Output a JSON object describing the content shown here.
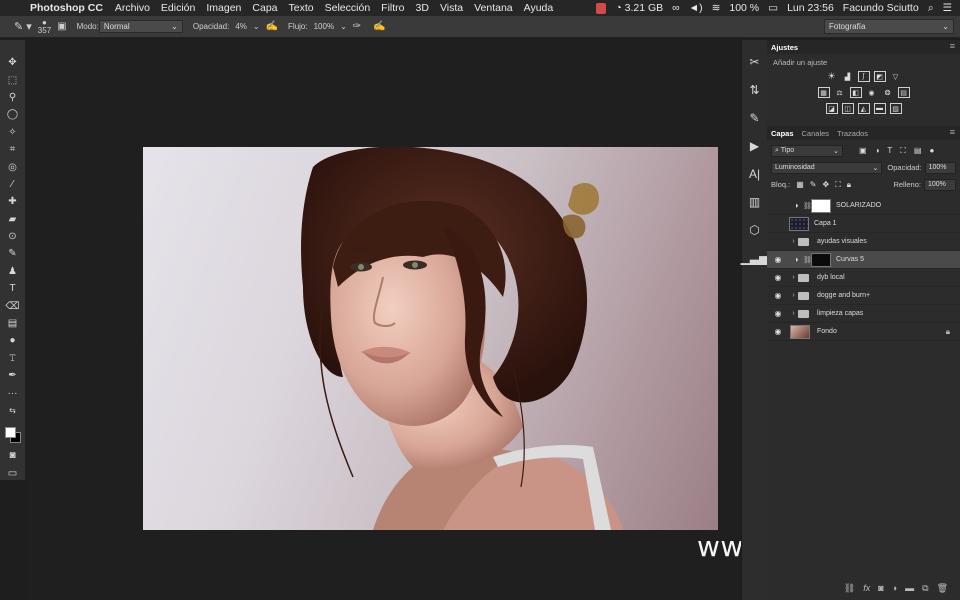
{
  "menubar": {
    "app_name": "Photoshop CC",
    "items": [
      "Archivo",
      "Edición",
      "Imagen",
      "Capa",
      "Texto",
      "Selección",
      "Filtro",
      "3D",
      "Vista",
      "Ventana",
      "Ayuda"
    ],
    "memory": "3.21 GB",
    "battery": "100 %",
    "clock": "Lun 23:56",
    "user": "Facundo Sciutto"
  },
  "options": {
    "brush_size": "357",
    "mode_label": "Modo:",
    "mode_value": "Normal",
    "opacity_label": "Opacidad:",
    "opacity_value": "4%",
    "flow_label": "Flujo:",
    "flow_value": "100%",
    "workspace": "Fotografía"
  },
  "adjustments": {
    "tab": "Ajustes",
    "subtitle": "Añadir un ajuste"
  },
  "layers": {
    "tabs": [
      "Capas",
      "Canales",
      "Trazados"
    ],
    "filter": "Tipo",
    "blend_mode": "Luminosidad",
    "opacity_label": "Opacidad:",
    "opacity_value": "100%",
    "lock_label": "Bloq.:",
    "fill_label": "Relleno:",
    "fill_value": "100%",
    "items": [
      {
        "name": "SOLARIZADO",
        "visible": false
      },
      {
        "name": "Capa 1",
        "visible": false
      },
      {
        "name": "ayudas visuales",
        "visible": false
      },
      {
        "name": "Curvas 5",
        "visible": true
      },
      {
        "name": "dyb local",
        "visible": true
      },
      {
        "name": "dogge and burn+",
        "visible": true
      },
      {
        "name": "limpieza capas",
        "visible": true
      },
      {
        "name": "Fondo",
        "visible": true
      }
    ]
  },
  "watermark": "www.hunls.com"
}
